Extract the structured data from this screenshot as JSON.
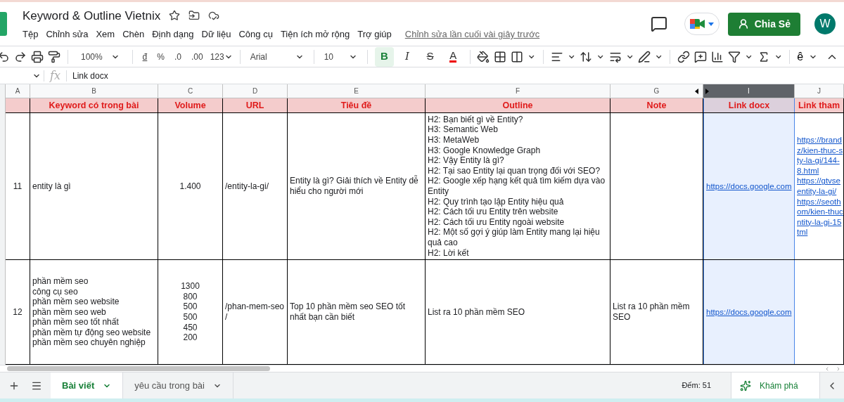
{
  "document": {
    "title": "Keyword & Outline Vietnix",
    "last_edit": "Chỉnh sửa lần cuối vài giây trước"
  },
  "menu": [
    "Tệp",
    "Chỉnh sửa",
    "Xem",
    "Chèn",
    "Định dạng",
    "Dữ liệu",
    "Công cụ",
    "Tiện ích mở rộng",
    "Trợ giúp"
  ],
  "share_button": {
    "label": "Chia Sẻ"
  },
  "avatar": {
    "initial": "W"
  },
  "toolbar": {
    "zoom": "100%",
    "currency": "đ",
    "percent": "%",
    "decrease_decimal": ".0",
    "increase_decimal": ".00",
    "more_formats": "123",
    "font": "Arial",
    "font_size": "10",
    "input_tools": "ê",
    "format_buttons": [
      {
        "kind": "bold",
        "label": "B",
        "active": true
      },
      {
        "kind": "italic",
        "label": "I",
        "active": false
      },
      {
        "kind": "strike",
        "label": "S",
        "active": false
      },
      {
        "kind": "text_color",
        "label": "A",
        "active": false
      }
    ]
  },
  "formula_bar": {
    "label": "fx",
    "value": "Link docx"
  },
  "columns": [
    {
      "letter": "A",
      "kind": "index",
      "selected": false
    },
    {
      "letter": "B",
      "kind": "text",
      "selected": false
    },
    {
      "letter": "C",
      "kind": "number",
      "selected": false
    },
    {
      "letter": "D",
      "kind": "text",
      "selected": false
    },
    {
      "letter": "E",
      "kind": "text",
      "selected": false
    },
    {
      "letter": "F",
      "kind": "text",
      "selected": false
    },
    {
      "letter": "G",
      "kind": "text",
      "selected": false
    },
    {
      "letter": "I",
      "kind": "link",
      "selected": true
    },
    {
      "letter": "J",
      "kind": "link",
      "selected": false
    }
  ],
  "header_row": {
    "B": "Keyword có trong bài",
    "C": "Volume",
    "D": "URL",
    "E": "Tiêu đề",
    "F": "Outline",
    "G": "Note",
    "I": "Link docx",
    "J": "Link tham"
  },
  "rows": [
    {
      "A": "11",
      "B": "entity là gì",
      "C": "1.400",
      "D": "/entity-la-gi/",
      "E": "Entity là gì? Giải thích về Entity dễ hiểu cho người mới",
      "F": "H2: Bạn biết gì về Entity?\nH3: Semantic Web\nH3: MetaWeb\nH3: Google Knowledge Graph\nH2: Vậy Entity là gì?\nH2: Tại sao Entity lại quan trọng đối với SEO?\nH2: Google xếp hạng kết quả tìm kiếm dựa vào Entity\nH2: Quy trình tạo lập Entity hiệu quả\nH2: Cách tối ưu Entity trên website\nH2: Cách tối ưu Entity ngoài website\nH2: Một số gợi ý giúp làm Entity mang lại hiệu quả cao\nH2: Lời kết",
      "I": "https://docs.google.com",
      "J": "https://brand\nz/kien-thuc-s\nty-la-gi/144-\n8.html\nhttps://gtvse\nentity-la-gi/\nhttps://seoth\nom/kien-thuc\nntity-la-gi-15\ntml"
    },
    {
      "A": "12",
      "B": "phần mềm seo\ncông cụ seo\nphần mềm seo website\nphần mềm seo web\nphần mềm seo tốt nhất\nphần mềm tự động seo website\nphần mềm seo chuyên nghiệp",
      "C": "1300\n800\n500\n500\n450\n200",
      "D": "/phan-mem-seo\n/",
      "E": "Top 10 phần mềm seo SEO tốt nhất bạn cần biết",
      "F": "List ra 10 phần mềm SEO",
      "G": "List ra 10 phần mềm SEO",
      "I": "https://docs.google.com"
    }
  ],
  "sheet_tabs": [
    {
      "label": "Bài viết",
      "selected": true
    },
    {
      "label": "yêu cầu trong bài",
      "selected": false
    }
  ],
  "status": "Đếm: 51",
  "explore": {
    "label": "Khám phá"
  }
}
